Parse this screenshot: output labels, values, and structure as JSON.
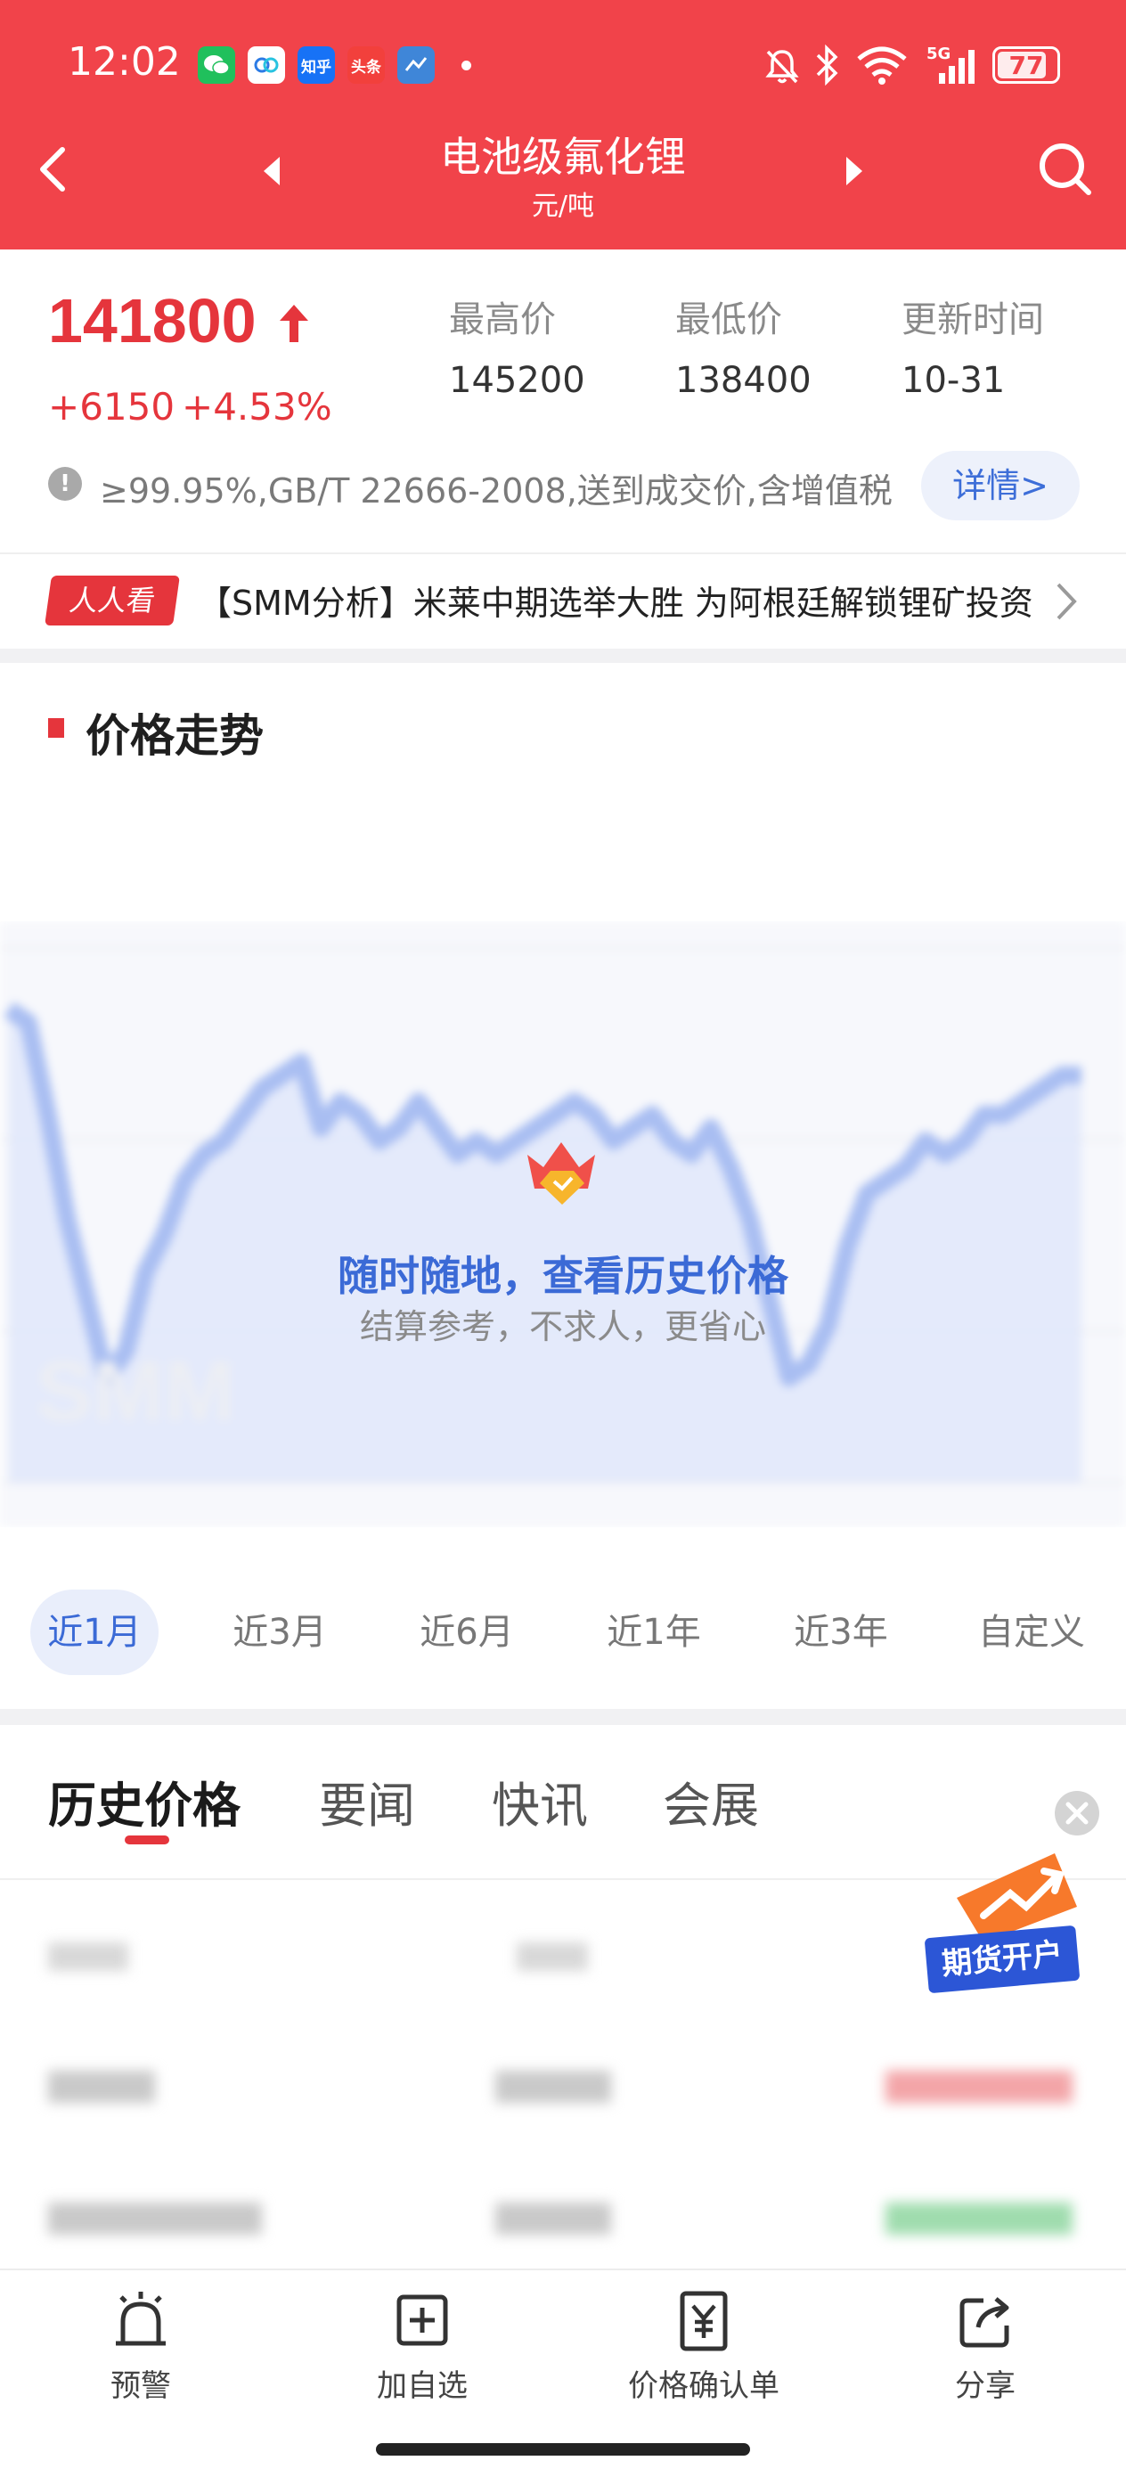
{
  "status_bar": {
    "time": "12:02",
    "apps": [
      "wechat",
      "baidu-netdisk",
      "知乎",
      "头条",
      "weather"
    ],
    "network": "5G",
    "battery": "77"
  },
  "nav": {
    "title": "电池级氟化锂",
    "unit": "元/吨"
  },
  "price": {
    "current": "141800",
    "change": "+6150",
    "change_pct": "+4.53%",
    "high_label": "最高价",
    "high_value": "145200",
    "low_label": "最低价",
    "low_value": "138400",
    "update_label": "更新时间",
    "update_value": "10-31",
    "spec": "≥99.95%,GB/T 22666-2008,送到成交价,含增值税",
    "detail_label": "详情>"
  },
  "news": {
    "badge": "人人看",
    "headline": "【SMM分析】米莱中期选举大胜 为阿根廷解锁锂矿投资"
  },
  "chart_section": {
    "title": "价格走势",
    "overlay_title": "随时随地，查看历史价格",
    "overlay_subtitle": "结算参考，不求人，更省心"
  },
  "chart_data": {
    "type": "area",
    "blurred": true,
    "values": [
      96,
      95,
      88,
      80,
      74,
      68,
      70,
      76,
      79,
      83,
      85,
      86,
      88,
      90,
      91,
      92,
      87,
      89,
      88,
      86,
      87,
      89,
      87,
      85,
      86,
      85,
      86,
      87,
      88,
      89,
      88,
      86,
      87,
      88,
      86,
      85,
      87,
      84,
      80,
      74,
      68,
      69,
      72,
      78,
      82,
      83,
      84,
      86,
      85,
      86,
      88,
      88,
      89,
      90,
      91,
      91
    ],
    "ylim": [
      60,
      100
    ],
    "color": "#a9bef2"
  },
  "range_tabs": [
    "近1月",
    "近3月",
    "近6月",
    "近1年",
    "近3年",
    "自定义"
  ],
  "news_tabs": [
    "历史价格",
    "要闻",
    "快讯",
    "会展"
  ],
  "promo": {
    "label": "期货开户"
  },
  "bottom_nav": [
    {
      "label": "预警",
      "icon": "alarm-icon"
    },
    {
      "label": "加自选",
      "icon": "add-icon"
    },
    {
      "label": "价格确认单",
      "icon": "price-doc-icon"
    },
    {
      "label": "分享",
      "icon": "share-icon"
    }
  ],
  "colors": {
    "brand_red": "#f1434a",
    "up_red": "#e5353c",
    "accent_blue": "#3b6ad6"
  }
}
